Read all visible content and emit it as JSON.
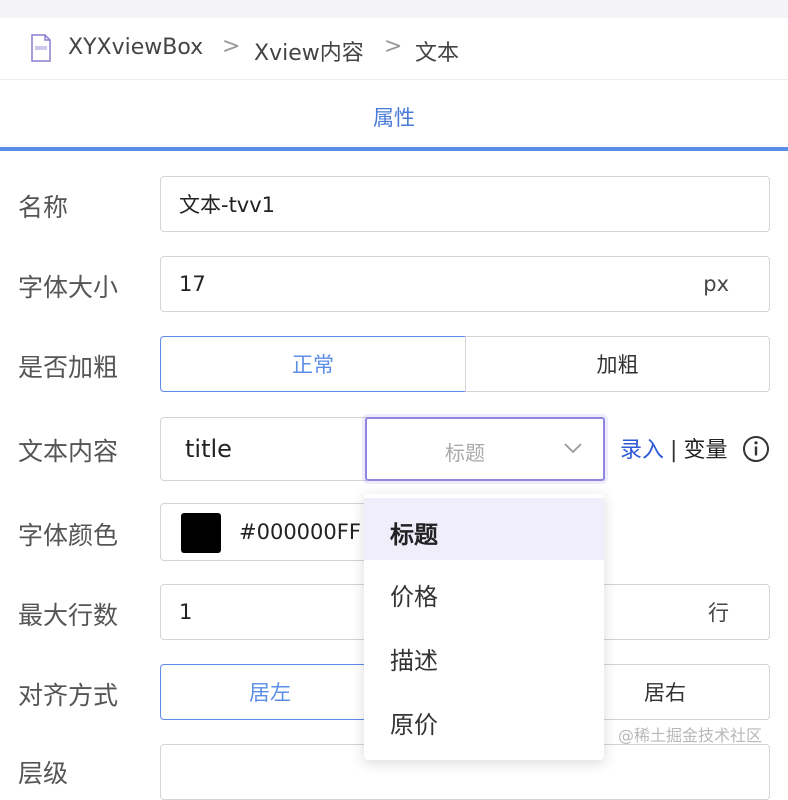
{
  "breadcrumb": {
    "items": [
      "XYXviewBox",
      "Xview内容",
      "文本"
    ],
    "separator": ">"
  },
  "tabs": {
    "active": "属性"
  },
  "form": {
    "name": {
      "label": "名称",
      "value": "文本-tvv1"
    },
    "font_size": {
      "label": "字体大小",
      "value": "17",
      "unit": "px"
    },
    "bold": {
      "label": "是否加粗",
      "options": [
        "正常",
        "加粗"
      ],
      "selected": "正常"
    },
    "text_content": {
      "label": "文本内容",
      "value": "title",
      "select_value": "标题",
      "record_link": "录入",
      "divider": "|",
      "variable_link": "变量"
    },
    "font_color": {
      "label": "字体颜色",
      "value": "#000000FF",
      "swatch_color": "#000000"
    },
    "max_lines": {
      "label": "最大行数",
      "value": "1",
      "unit": "行"
    },
    "align": {
      "label": "对齐方式",
      "options": [
        "居左",
        "居右"
      ],
      "selected": "居左"
    },
    "level": {
      "label": "层级"
    }
  },
  "dropdown": {
    "options": [
      "标题",
      "价格",
      "描述",
      "原价"
    ],
    "selected": "标题"
  },
  "watermark": "@稀土掘金技术社区",
  "colors": {
    "accent": "#5b8ee6",
    "select_border": "#8e86e0",
    "link": "#2f5bd6",
    "dropdown_selected_bg": "#f1eefc"
  }
}
